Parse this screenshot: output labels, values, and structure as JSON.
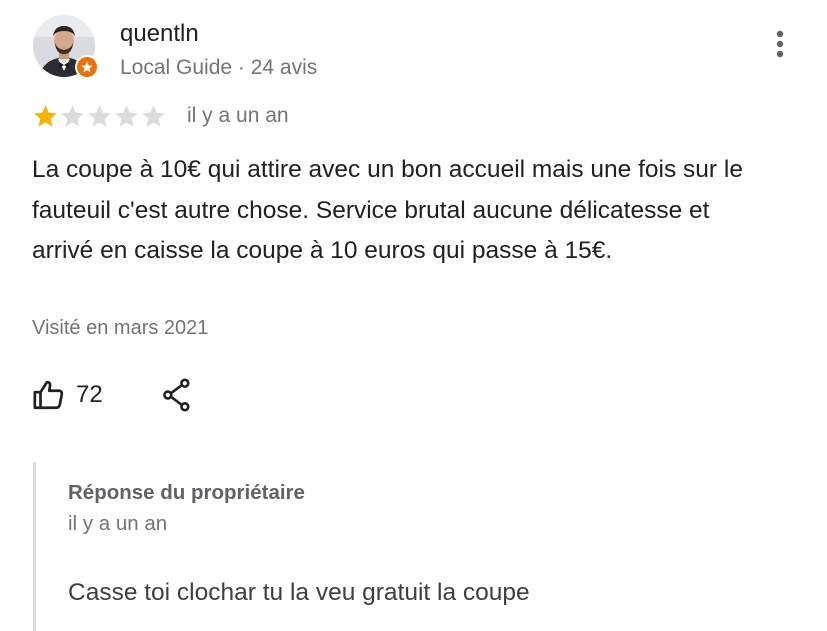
{
  "reviewer": {
    "name": "quentln",
    "meta": "Local Guide · 24 avis",
    "badge_icon": "local-guide-star-icon",
    "badge_color": "#e8710a"
  },
  "review": {
    "rating": 1,
    "max_rating": 5,
    "star_color_filled": "#f4b400",
    "star_color_empty": "#dadce0",
    "date": "il y a un an",
    "text": "La coupe à 10€ qui attire avec un bon accueil mais une fois sur le fauteuil c'est autre chose. Service brutal aucune délicatesse et arrivé en caisse la coupe à 10 euros qui passe à 15€.",
    "visited": "Visité en mars 2021"
  },
  "actions": {
    "like_icon": "thumbs-up-icon",
    "like_count": "72",
    "share_icon": "share-icon",
    "more_icon": "more-vert-icon"
  },
  "owner_reply": {
    "title": "Réponse du propriétaire",
    "date": "il y a un an",
    "text": "Casse toi clochar tu la veu gratuit la coupe"
  }
}
